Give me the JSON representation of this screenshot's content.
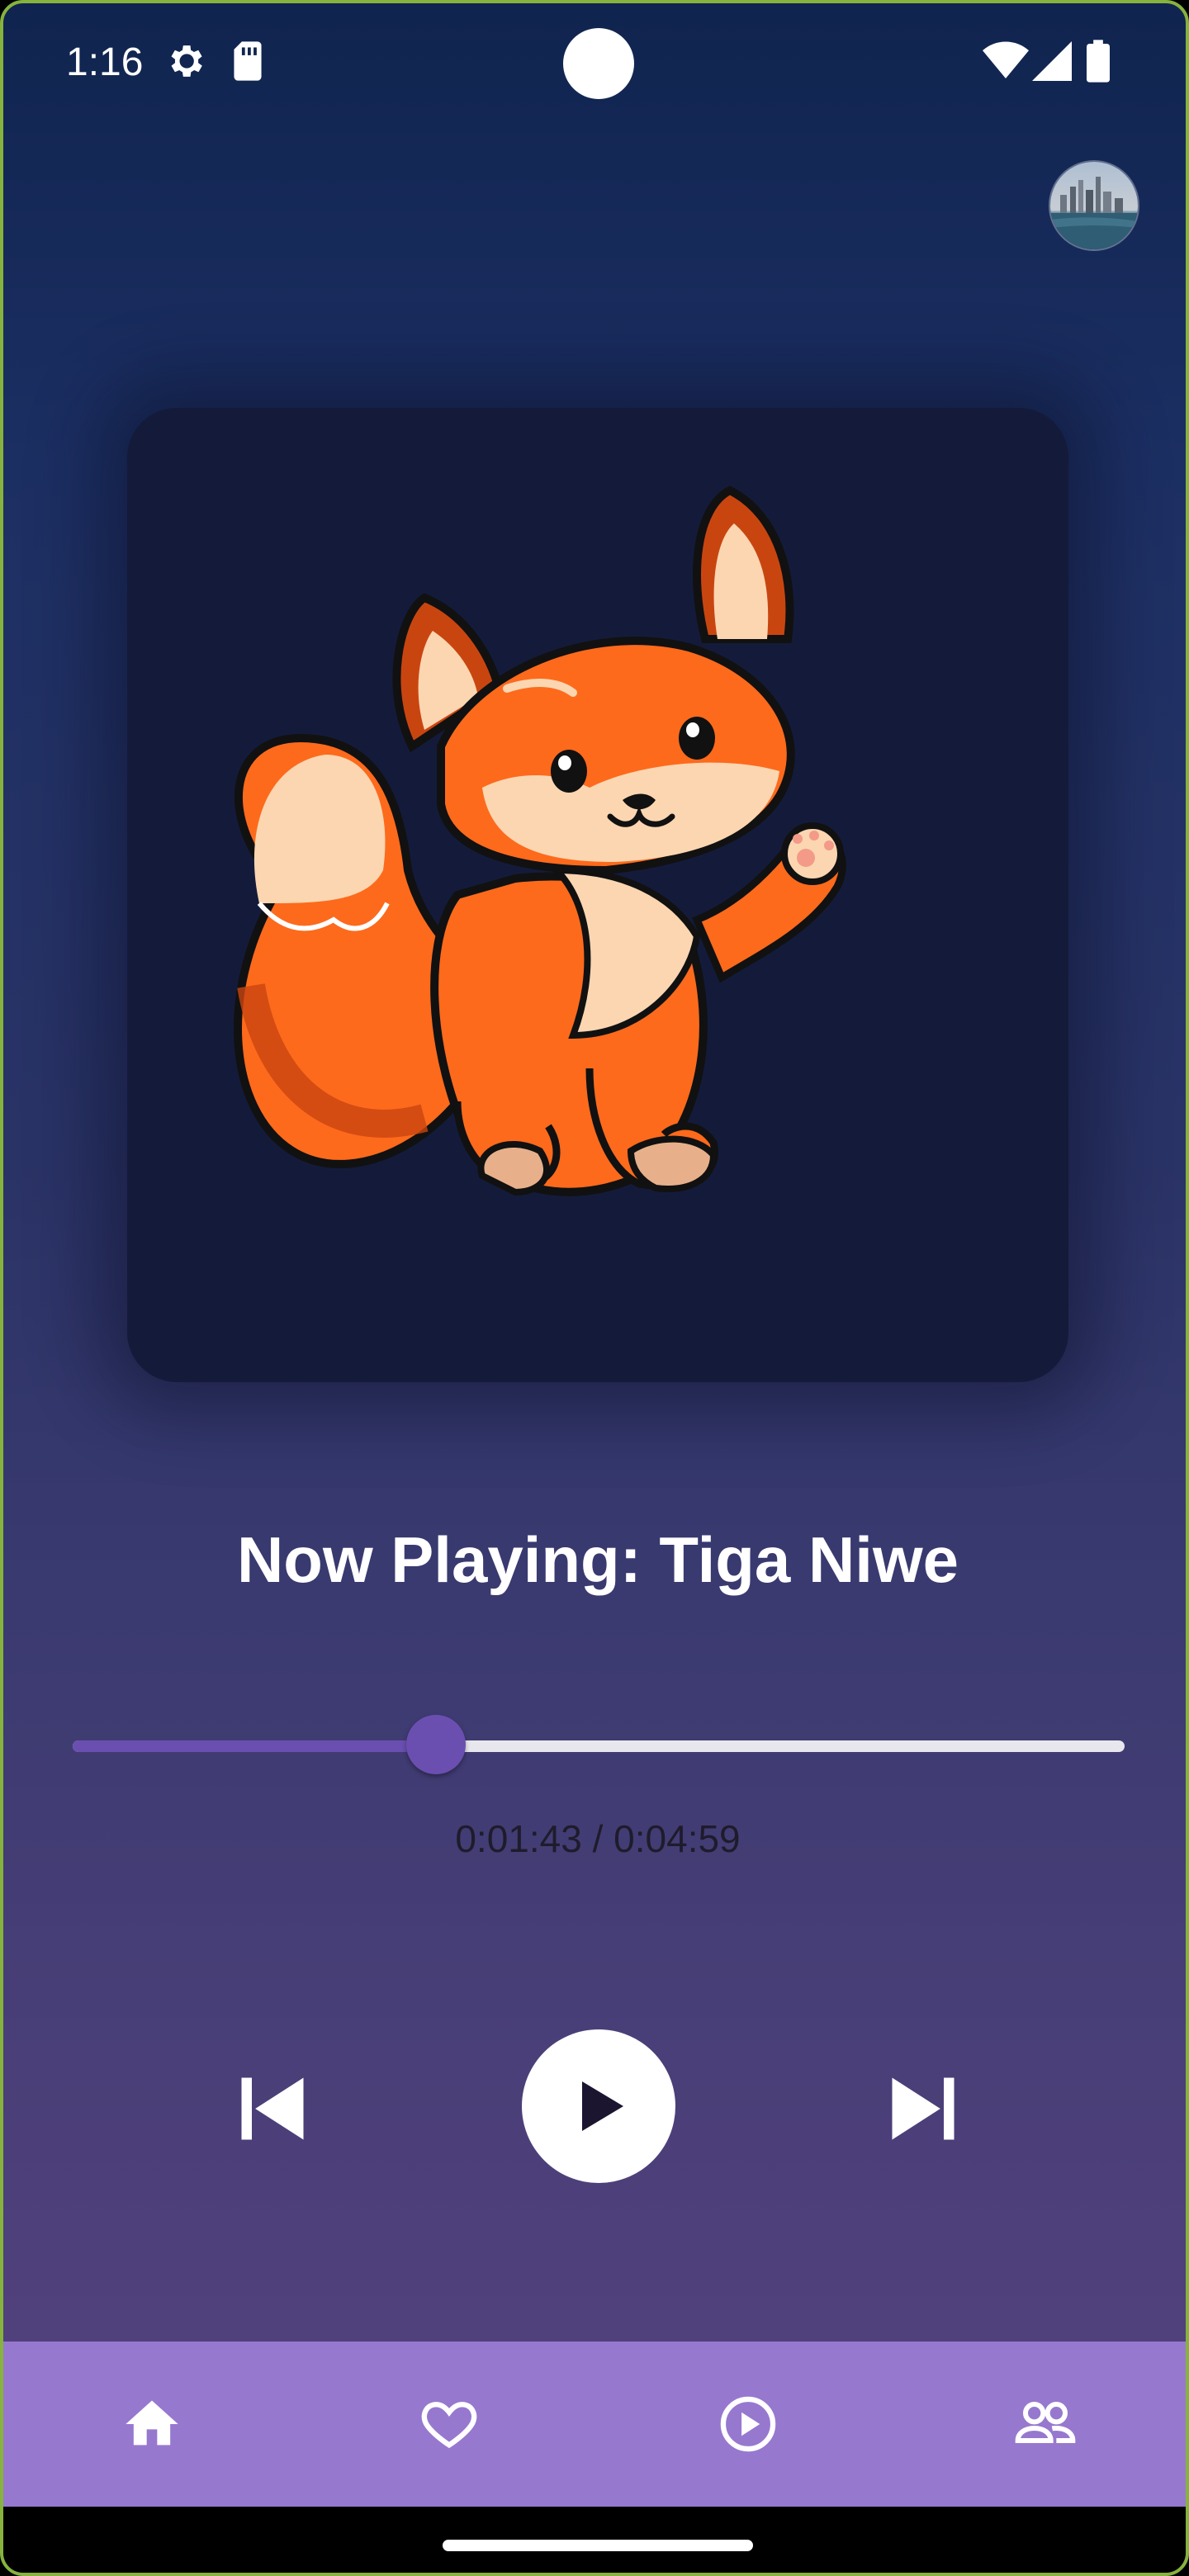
{
  "status_bar": {
    "time": "1:16",
    "icons": [
      "settings-gear-icon",
      "sd-card-icon",
      "wifi-icon",
      "cell-signal-icon",
      "battery-icon"
    ]
  },
  "header": {
    "avatar": "profile-avatar-city-skyline"
  },
  "album_art": {
    "image": "cartoon-fox-waving-illustration"
  },
  "player": {
    "title": "Now Playing: Tiga Niwe",
    "progress_fraction": 0.345,
    "time_display": "0:01:43 / 0:04:59",
    "controls": [
      "skip-previous-icon",
      "play-icon",
      "skip-next-icon"
    ]
  },
  "bottom_nav": {
    "items": [
      "home-icon",
      "favorite-heart-icon",
      "play-circle-icon",
      "people-icon"
    ]
  },
  "colors": {
    "accent": "#6a4fb0",
    "nav_background": "#9778cf",
    "track": "#e9e7ee",
    "fox_orange": "#fd6a1c"
  }
}
